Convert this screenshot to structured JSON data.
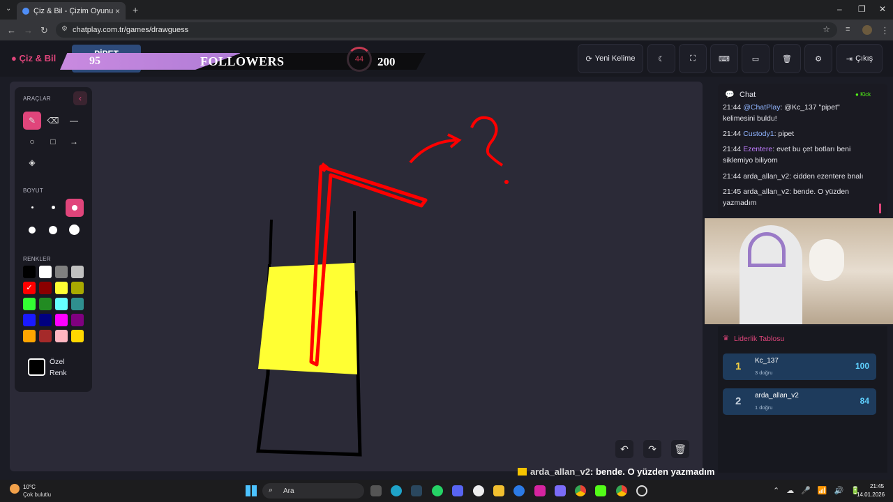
{
  "browser": {
    "tab_title": "Çiz & Bil - Çizim Oyunu",
    "url": "chatplay.com.tr/games/drawguess"
  },
  "header": {
    "logo": "Çiz & Bil",
    "word": "PİPET",
    "followers_count": "95",
    "followers_label": "FOLLOWERS",
    "timer": "44",
    "goal": "200",
    "new_word_label": "Yeni Kelime",
    "logout_label": "Çıkış"
  },
  "tools": {
    "title": "ARAÇLAR",
    "size_title": "BOYUT",
    "colors_title": "RENKLER",
    "custom_color_label1": "Özel",
    "custom_color_label2": "Renk",
    "colors": [
      "#000000",
      "#ffffff",
      "#808080",
      "#c0c0c0",
      "#ff0000",
      "#8b0000",
      "#ffff33",
      "#a9a900",
      "#33ff33",
      "#228b22",
      "#66ffff",
      "#2f8f8f",
      "#1a1aff",
      "#000080",
      "#ff00ff",
      "#800080",
      "#ffa500",
      "#a52a2a",
      "#ffb6c1",
      "#ffd700"
    ]
  },
  "chat": {
    "title": "Chat",
    "platform": "Kick",
    "messages": [
      {
        "time": "21:44",
        "user": "@ChatPlay",
        "text": ": @Kc_137 \"pipet\" kelimesini buldu!",
        "user_color": "#8fb4ff"
      },
      {
        "time": "21:44",
        "user": "Custody1",
        "text": ": pipet",
        "user_color": "#8fb4ff"
      },
      {
        "time": "21:44",
        "user": "Ezentere",
        "text": ": evet bu çet botları beni siklemiyo biliyom",
        "user_color": "#c07cff"
      },
      {
        "time": "21:44",
        "user": "arda_allan_v2",
        "text": ": cidden ezentere bnalı",
        "user_color": "#e4e4ea"
      },
      {
        "time": "21:45",
        "user": "arda_allan_v2",
        "text": ": bende. O yüzden yazmadım",
        "user_color": "#e4e4ea"
      }
    ]
  },
  "leaderboard": {
    "title": "Liderlik Tablosu",
    "rows": [
      {
        "rank": "1",
        "name": "Kc_137",
        "sub": "3 doğru",
        "score": "100"
      },
      {
        "rank": "2",
        "name": "arda_allan_v2",
        "sub": "1 doğru",
        "score": "84"
      }
    ]
  },
  "ticker": {
    "user": "arda_allan_v2",
    "text": ": bende. O yüzden yazmadım"
  },
  "taskbar": {
    "weather_temp": "10°C",
    "weather_desc": "Çok bulutlu",
    "search_placeholder": "Ara",
    "time": "21:45",
    "date": "14.01.2026"
  }
}
